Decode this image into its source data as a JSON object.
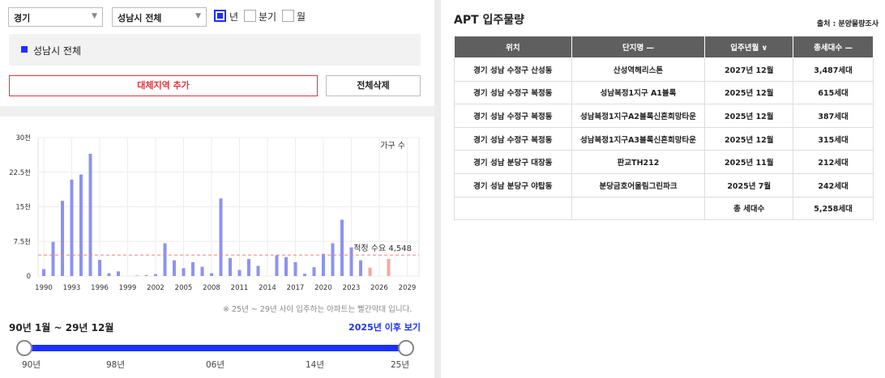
{
  "filters": {
    "province": "경기",
    "city": "성남시 전체",
    "periods": [
      {
        "label": "년",
        "checked": true
      },
      {
        "label": "분기",
        "checked": false
      },
      {
        "label": "월",
        "checked": false
      }
    ]
  },
  "region_selected": "성남시 전체",
  "buttons": {
    "add_region": "대체지역 추가",
    "delete_all": "전체삭제"
  },
  "chart_data": {
    "type": "bar",
    "series_name": "가구 수",
    "y_ticks": [
      "30천",
      "22.5천",
      "15천",
      "7.5천",
      "0"
    ],
    "ylim": [
      0,
      30000
    ],
    "x_ticks": [
      "1990",
      "1993",
      "1996",
      "1999",
      "2002",
      "2005",
      "2008",
      "2011",
      "2014",
      "2017",
      "2020",
      "2023",
      "2026",
      "2029"
    ],
    "years": [
      1990,
      1991,
      1992,
      1993,
      1994,
      1995,
      1996,
      1997,
      1998,
      1999,
      2000,
      2001,
      2002,
      2003,
      2004,
      2005,
      2006,
      2007,
      2008,
      2009,
      2010,
      2011,
      2012,
      2013,
      2014,
      2015,
      2016,
      2017,
      2018,
      2019,
      2020,
      2021,
      2022,
      2023,
      2024,
      2025,
      2026,
      2027,
      2028
    ],
    "values": [
      1500,
      7400,
      16300,
      20900,
      22000,
      26500,
      3500,
      600,
      1000,
      0,
      100,
      200,
      400,
      7100,
      3400,
      1700,
      3000,
      2000,
      600,
      16800,
      3900,
      1300,
      3700,
      2200,
      0,
      4500,
      4100,
      3000,
      500,
      1900,
      4800,
      7100,
      12200,
      6200,
      3400,
      1800,
      0,
      3700,
      0
    ],
    "forecast_from_year": 2025,
    "colors": {
      "actual": "#8c93f0",
      "forecast": "#f5a6a0",
      "demand_line": "#e8847c"
    },
    "demand_label": "적정 수요 4,548",
    "demand_value": 4548,
    "grid": true
  },
  "note": "※ 25년 ~ 29년 사이 입주하는 아파트는 빨간막대 입니다.",
  "range": {
    "label": "90년 1월 ~ 29년 12월",
    "after_link": "2025년 이후 보기",
    "ticks": [
      "90년",
      "98년",
      "06년",
      "14년",
      "25년"
    ],
    "start_fraction": 0,
    "end_fraction": 1
  },
  "panel": {
    "title": "APT 입주물량",
    "source": "출처 : 분양물량조사",
    "columns": [
      "위치",
      "단지명 —",
      "입주년월 ∨",
      "총세대수 —"
    ],
    "rows": [
      [
        "경기 성남 수정구 산성동",
        "산성역헤리스톤",
        "2027년 12월",
        "3,487세대"
      ],
      [
        "경기 성남 수정구 복정동",
        "성남복정1지구 A1블록",
        "2025년 12월",
        "615세대"
      ],
      [
        "경기 성남 수정구 복정동",
        "성남복정1지구A2블록신혼희망타운",
        "2025년 12월",
        "387세대"
      ],
      [
        "경기 성남 수정구 복정동",
        "성남복정1지구A3블록신혼희망타운",
        "2025년 12월",
        "315세대"
      ],
      [
        "경기 성남 분당구 대장동",
        "판교TH212",
        "2025년 11월",
        "212세대"
      ],
      [
        "경기 성남 분당구 야탑동",
        "분당금호어울림그린파크",
        "2025년 7월",
        "242세대"
      ]
    ],
    "total_label": "총 세대수",
    "total_value": "5,258세대"
  },
  "colors": {
    "accent": "#1a30ff",
    "danger": "#e0353b",
    "header_bg": "#5f5f5f"
  }
}
